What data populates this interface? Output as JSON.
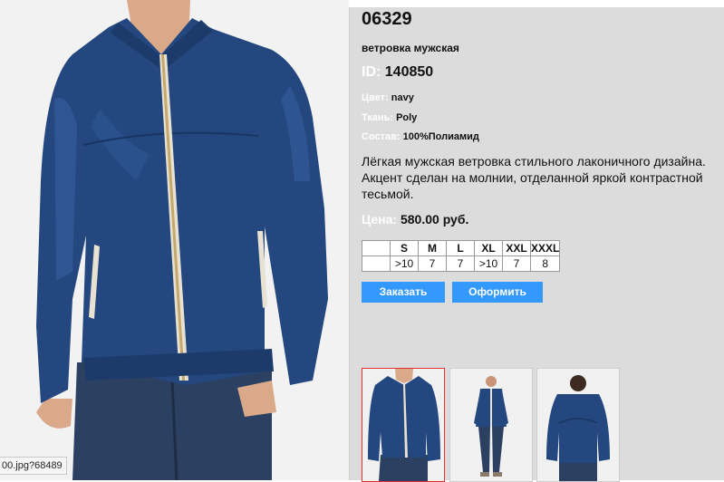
{
  "product": {
    "code": "06329",
    "name": "ветровка мужская",
    "id_label": "ID:",
    "id_value": "140850",
    "color_label": "Цвет:",
    "color_value": "navy",
    "fabric_label": "Ткань:",
    "fabric_value": "Poly",
    "composition_label": "Состав:",
    "composition_value": "100%Полиамид",
    "description": "Лёгкая мужская ветровка стильного лаконичного дизайна. Акцент сделан на молнии, отделанной яркой контрастной тесьмой.",
    "price_label": "Цена:",
    "price_value": "580.00 руб."
  },
  "sizes": {
    "headers": [
      "",
      "S",
      "M",
      "L",
      "XL",
      "XXL",
      "XXXL"
    ],
    "stock": [
      "",
      ">10",
      "7",
      "7",
      ">10",
      "7",
      "8"
    ]
  },
  "buttons": {
    "order": "Заказать",
    "checkout": "Оформить"
  },
  "status_url": "00.jpg?68489",
  "colors": {
    "jacket": "#23477e",
    "jeans": "#2c4161",
    "accent": "#3399ff",
    "panel": "#dcdcdc"
  }
}
